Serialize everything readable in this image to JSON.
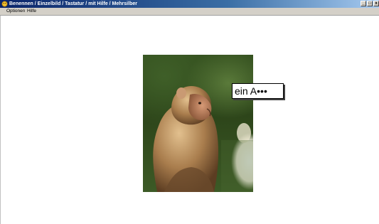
{
  "window": {
    "title": "Benennen / Einzelbild / Tastatur / mit Hilfe / Mehrsilber",
    "controls": {
      "minimize": "_",
      "maximize": "□",
      "close": "x"
    }
  },
  "menu": {
    "items": [
      "Optionen",
      "Hilfe"
    ]
  },
  "stimulus": {
    "image_subject": "monkey",
    "caption": "ein A•••"
  },
  "colors": {
    "titlebar_start": "#0a246a",
    "titlebar_end": "#a6caf0",
    "menubar_bg": "#d4d0c8",
    "client_bg": "#ffffff"
  }
}
